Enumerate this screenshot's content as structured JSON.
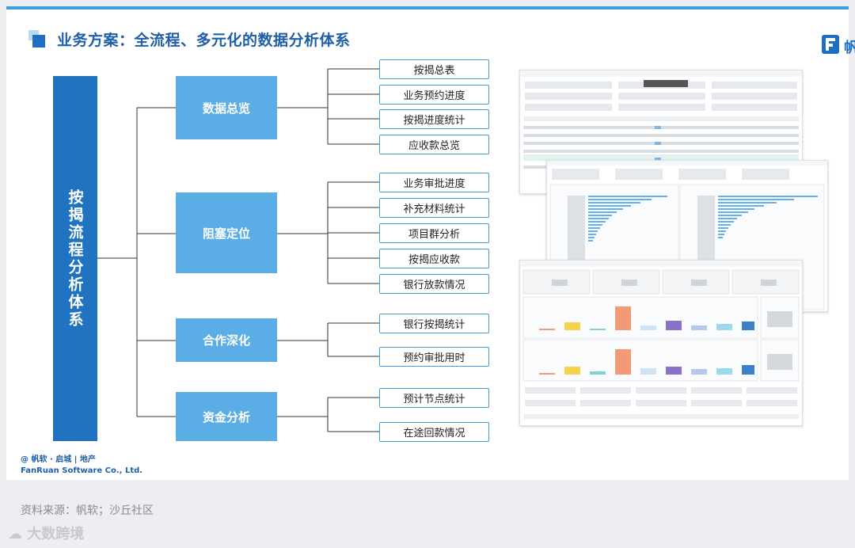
{
  "title": "业务方案：全流程、多元化的数据分析体系",
  "logo_text": "帆软",
  "root_label": "按揭流程分析体系",
  "categories": [
    {
      "label": "数据总览",
      "items": [
        "按揭总表",
        "业务预约进度",
        "按揭进度统计",
        "应收款总览"
      ]
    },
    {
      "label": "阻塞定位",
      "items": [
        "业务审批进度",
        "补充材料统计",
        "项目群分析",
        "按揭应收款",
        "银行放款情况"
      ]
    },
    {
      "label": "合作深化",
      "items": [
        "银行按揭统计",
        "预约审批用时"
      ]
    },
    {
      "label": "资金分析",
      "items": [
        "预计节点统计",
        "在途回款情况"
      ]
    }
  ],
  "footer": {
    "line1": "@ 帆软 · 启城 | 地产",
    "line2": "FanRuan Software Co., Ltd."
  },
  "source": "资料来源：帆软；沙丘社区",
  "watermark": "大数跨境",
  "colors": {
    "primary": "#1f73c1",
    "category": "#5aaee5",
    "leaf_border": "#3d9ee0",
    "title": "#1f5fa6"
  },
  "screenshots": [
    {
      "name": "dashboard-table-screenshot"
    },
    {
      "name": "dashboard-bar-list-screenshot"
    },
    {
      "name": "dashboard-column-chart-screenshot"
    }
  ]
}
